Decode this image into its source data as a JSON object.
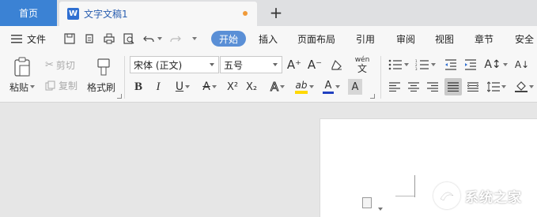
{
  "tabs": {
    "home": "首页",
    "document": "文字文稿1",
    "doc_icon_letter": "W",
    "add": "+"
  },
  "menu": {
    "file": "文件",
    "items": [
      "开始",
      "插入",
      "页面布局",
      "引用",
      "审阅",
      "视图",
      "章节",
      "安全"
    ],
    "active_index": 0
  },
  "ribbon": {
    "paste": "粘贴",
    "cut": "剪切",
    "copy": "复制",
    "format_painter": "格式刷",
    "font_name": "宋体 (正文)",
    "font_size": "五号",
    "grow_font": "A⁺",
    "shrink_font": "A⁻",
    "bold": "B",
    "italic": "I",
    "underline": "U",
    "strikethrough": "A",
    "superscript": "X²",
    "subscript": "X₂",
    "font_effect": "A",
    "highlight": "ab",
    "font_color": "A",
    "char_shading": "A",
    "phonetic": "wén"
  },
  "watermark": {
    "text": "系统之家"
  },
  "colors": {
    "accent": "#3b82d4",
    "active_tab_pill": "#5a8fd6",
    "modified_dot": "#f09a39",
    "highlight_yellow": "#ffd800",
    "font_red": "#d23b3b",
    "font_blue": "#2040c0"
  }
}
